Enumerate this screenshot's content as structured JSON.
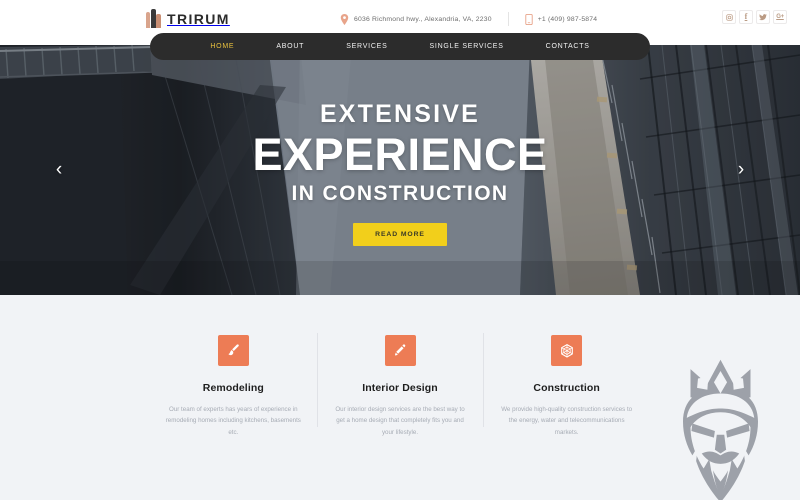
{
  "site": {
    "logo_text": "TRIRUM",
    "logo_icon": "building-icon"
  },
  "topbar": {
    "address": "6036 Richmond hwy., Alexandria, VA, 2230",
    "address_icon": "map-pin-icon",
    "phone": "+1 (409) 987-5874",
    "phone_icon": "phone-icon",
    "socials": [
      {
        "name": "instagram-icon",
        "glyph": "▣"
      },
      {
        "name": "facebook-icon",
        "glyph": "f"
      },
      {
        "name": "twitter-icon",
        "glyph": "ᵛ"
      },
      {
        "name": "googleplus-icon",
        "glyph": "G+"
      }
    ]
  },
  "nav": {
    "items": [
      {
        "label": "HOME",
        "active": true
      },
      {
        "label": "ABOUT",
        "active": false
      },
      {
        "label": "SERVICES",
        "active": false
      },
      {
        "label": "SINGLE SERVICES",
        "active": false
      },
      {
        "label": "CONTACTS",
        "active": false
      }
    ]
  },
  "hero": {
    "line1": "EXTENSIVE",
    "line2": "EXPERIENCE",
    "line3": "IN CONSTRUCTION",
    "cta_label": "READ MORE",
    "prev_arrow": "‹",
    "next_arrow": "›",
    "image_description": "glass-office-buildings-looking-up"
  },
  "services": {
    "cards": [
      {
        "icon": "paintbrush-icon",
        "title": "Remodeling",
        "description": "Our team of experts has years of experience in remodeling homes including kitchens, basements etc."
      },
      {
        "icon": "pencil-icon",
        "title": "Interior Design",
        "description": "Our interior design services are the best way to get a home design that completely fits you and your lifestyle."
      },
      {
        "icon": "hexagon-gear-icon",
        "title": "Construction",
        "description": "We provide high-quality construction services to the energy, water and telecommunications markets."
      }
    ]
  },
  "watermark": {
    "name": "king-mask-watermark",
    "color": "#9a9ea6"
  },
  "colors": {
    "accent_orange": "#ed7c55",
    "accent_yellow": "#f2cf1b",
    "nav_dark": "#2c2c2c",
    "nav_active": "#e8c03e",
    "section_bg": "#f1f3f6",
    "body_text": "#a7acb5"
  }
}
